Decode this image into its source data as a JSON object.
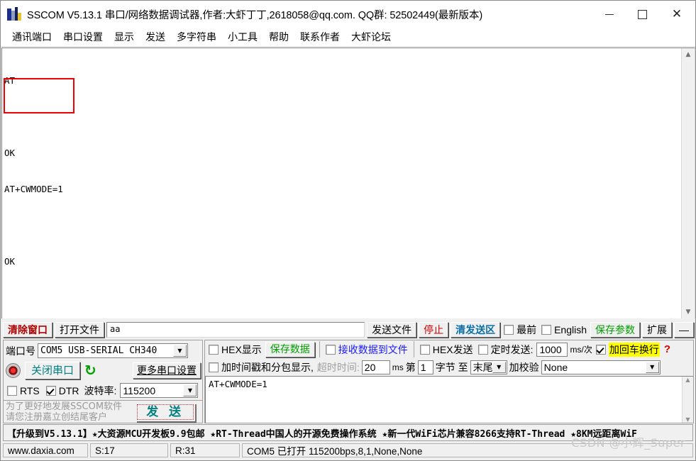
{
  "window": {
    "title": "SSCOM V5.13.1 串口/网络数据调试器,作者:大虾丁丁,2618058@qq.com. QQ群: 52502449(最新版本)",
    "minimize_label": "–",
    "maximize_label": "□",
    "close_label": "✕",
    "app_icon": "sscom-app-icon"
  },
  "menu": {
    "items": [
      {
        "label": "通讯端口"
      },
      {
        "label": "串口设置"
      },
      {
        "label": "显示"
      },
      {
        "label": "发送"
      },
      {
        "label": "多字符串"
      },
      {
        "label": "小工具"
      },
      {
        "label": "帮助"
      },
      {
        "label": "联系作者"
      },
      {
        "label": "大虾论坛"
      }
    ]
  },
  "terminal": {
    "lines": [
      "AT",
      "",
      "OK",
      "AT+CWMODE=1",
      "",
      "OK"
    ],
    "annotation_box_color": "#ee0000",
    "scroll_up_icon": "▲",
    "scroll_down_icon": "▼"
  },
  "toolbar": {
    "clear_window": "清除窗口",
    "open_file": "打开文件",
    "file_path_value": "aa",
    "file_path_placeholder": "",
    "send_file": "发送文件",
    "stop": "停止",
    "clear_send": "清发送区",
    "topmost_label": "最前",
    "topmost_checked": false,
    "english_label": "English",
    "english_checked": false,
    "save_params": "保存参数",
    "extend": "扩展",
    "collapse": "—"
  },
  "port_panel": {
    "port_label": "端口号",
    "port_value": "COM5 USB-SERIAL CH340",
    "close_port_button": "关闭串口",
    "refresh_icon": "↻",
    "more_settings": "更多串口设置",
    "rts_label": "RTS",
    "rts_checked": false,
    "dtr_label": "DTR",
    "dtr_checked": true,
    "baud_label": "波特率:",
    "baud_value": "115200",
    "promo_text": "为了更好地发展SSCOM软件\n请您注册嘉立创结尾客户",
    "send_button": "发 送",
    "led_icon": "status-led-icon"
  },
  "recv_panel": {
    "hex_display_label": "HEX显示",
    "hex_display_checked": false,
    "save_data_button": "保存数据",
    "recv_to_file_label": "接收数据到文件",
    "recv_to_file_checked": false,
    "timestamp_label": "加时间戳和分包显示,",
    "timestamp_checked": false,
    "timeout_label": "超时时间:",
    "timeout_value": "20",
    "timeout_unit": "ms"
  },
  "send_panel": {
    "hex_send_label": "HEX发送",
    "hex_send_checked": false,
    "timed_send_label": "定时发送:",
    "timed_send_checked": false,
    "interval_value": "1000",
    "interval_unit": "ms/次",
    "crlf_label": "加回车换行",
    "crlf_checked": true,
    "crlf_highlight": "#ffff00",
    "help_marker": "?",
    "byte_prefix": "第",
    "byte_start_value": "1",
    "byte_label": "字节 至",
    "byte_end_value": "末尾",
    "checksum_label": "加校验",
    "checksum_value": "None",
    "send_text": "AT+CWMODE=1"
  },
  "ad_banner": {
    "text": "【升级到V5.13.1】★大资源MCU开发板9.9包邮 ★RT-Thread中国人的开源免费操作系统 ★新一代WiFi芯片兼容8266支持RT-Thread ★8KM远距离WiF"
  },
  "status_bar": {
    "url": "www.daxia.com",
    "sent": "S:17",
    "received": "R:31",
    "connection": "COM5 已打开  115200bps,8,1,None,None"
  },
  "watermark": {
    "text": "CSDN @小辉_Super"
  }
}
